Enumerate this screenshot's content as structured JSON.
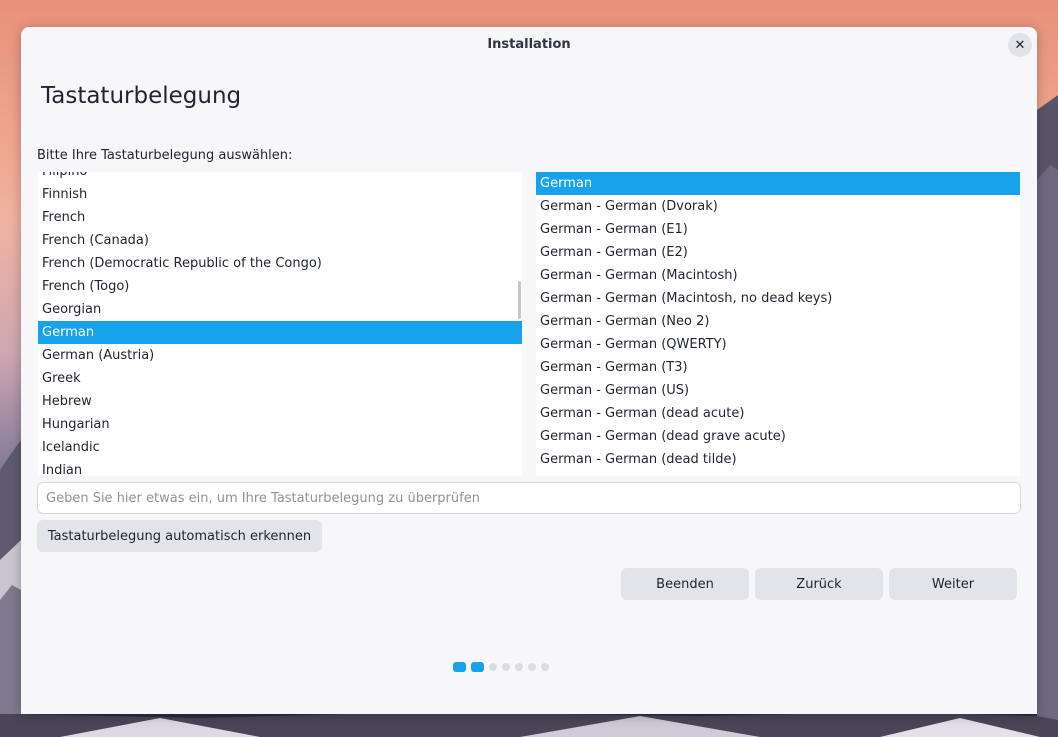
{
  "window": {
    "title": "Installation",
    "close_icon": "close-icon"
  },
  "page": {
    "heading": "Tastaturbelegung",
    "prompt": "Bitte Ihre Tastaturbelegung auswählen:"
  },
  "layouts": {
    "items": [
      "Filipino",
      "Finnish",
      "French",
      "French (Canada)",
      "French (Democratic Republic of the Congo)",
      "French (Togo)",
      "Georgian",
      "German",
      "German (Austria)",
      "Greek",
      "Hebrew",
      "Hungarian",
      "Icelandic",
      "Indian"
    ],
    "selected": "German"
  },
  "variants": {
    "items": [
      "German",
      "German - German (Dvorak)",
      "German - German (E1)",
      "German - German (E2)",
      "German - German (Macintosh)",
      "German - German (Macintosh, no dead keys)",
      "German - German (Neo 2)",
      "German - German (QWERTY)",
      "German - German (T3)",
      "German - German (US)",
      "German - German (dead acute)",
      "German - German (dead grave acute)",
      "German - German (dead tilde)"
    ],
    "selected": "German"
  },
  "test_field": {
    "value": "",
    "placeholder": "Geben Sie hier etwas ein, um Ihre Tastaturbelegung zu überprüfen"
  },
  "buttons": {
    "detect": "Tastaturbelegung automatisch erkennen",
    "quit": "Beenden",
    "back": "Zurück",
    "next": "Weiter"
  },
  "progress": {
    "total_steps": 7,
    "current_step": 2
  },
  "colors": {
    "accent": "#16a3ec",
    "button": "#e2e4ea",
    "window": "#f7f7fa"
  }
}
